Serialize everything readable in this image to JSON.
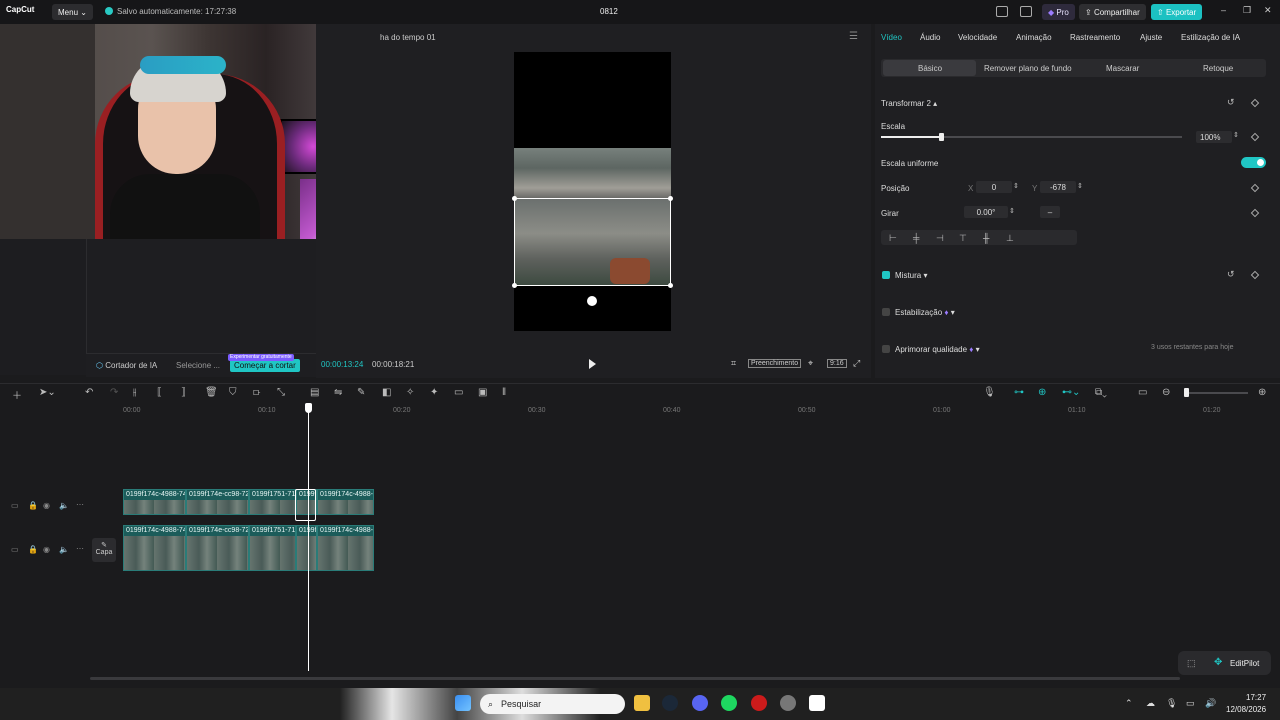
{
  "app": {
    "logo": "CapCut",
    "menu_label": "Menu",
    "autosave": "Salvo automaticamente: 17:27:38",
    "project_title": "0812",
    "pro_label": "Pro",
    "share_label": "Compartilhar",
    "export_label": "Exportar",
    "win_min": "–",
    "win_max": "❐",
    "win_close": "✕"
  },
  "media": {
    "ai_cutter_label": "Cortador de IA",
    "select_label": "Selecione ...",
    "start_cut_label": "Começar a cortar",
    "free_trial_tag": "Experimentar gratuitamente"
  },
  "player": {
    "title": "ha do tempo 01",
    "current_time": "00:00:13:24",
    "total_time": "00:00:18:21",
    "fill_label": "Preenchimento",
    "ratio_label": "9:16"
  },
  "props": {
    "tabs": [
      "Vídeo",
      "Áudio",
      "Velocidade",
      "Animação",
      "Rastreamento",
      "Ajuste",
      "Estilização de IA"
    ],
    "subtabs": [
      "Básico",
      "Remover plano de fundo",
      "Mascarar",
      "Retoque"
    ],
    "transform_title": "Transformar 2",
    "scale_label": "Escala",
    "scale_value": "100%",
    "scale_level": 0.2,
    "uniform_scale_label": "Escala uniforme",
    "position_label": "Posição",
    "pos_x_label": "X",
    "pos_x": "0",
    "pos_y_label": "Y",
    "pos_y": "-678",
    "rotate_label": "Girar",
    "rotate_value": "0.00°",
    "rotate_dash": "–",
    "blend_label": "Mistura",
    "stabilize_label": "Estabilização",
    "enhance_label": "Aprimorar qualidade",
    "enhance_hint": "3 usos restantes para hoje"
  },
  "timeline": {
    "ruler": [
      "00:00",
      "00:10",
      "00:20",
      "00:30",
      "00:40",
      "00:50",
      "01:00",
      "01:10",
      "01:20"
    ],
    "track1_clips": [
      "0199f174c-4988-74",
      "0199f174e-cc98-722",
      "0199f1751-71ca",
      "0199f",
      "0199f174c-4988-74"
    ],
    "track2_clips": [
      "0199f174c-4988-74",
      "0199f174e-cc98-722",
      "0199f1751-71ca",
      "0199f",
      "0199f174c-4988-74"
    ],
    "cover_label": "Capa",
    "editpilot_label": "EditPilot"
  },
  "taskbar": {
    "search_placeholder": "Pesquisar",
    "time": "17:27",
    "date": "12/08/2026"
  },
  "colors": {
    "accent": "#20c6c4",
    "clip": "#1c5c5a"
  }
}
